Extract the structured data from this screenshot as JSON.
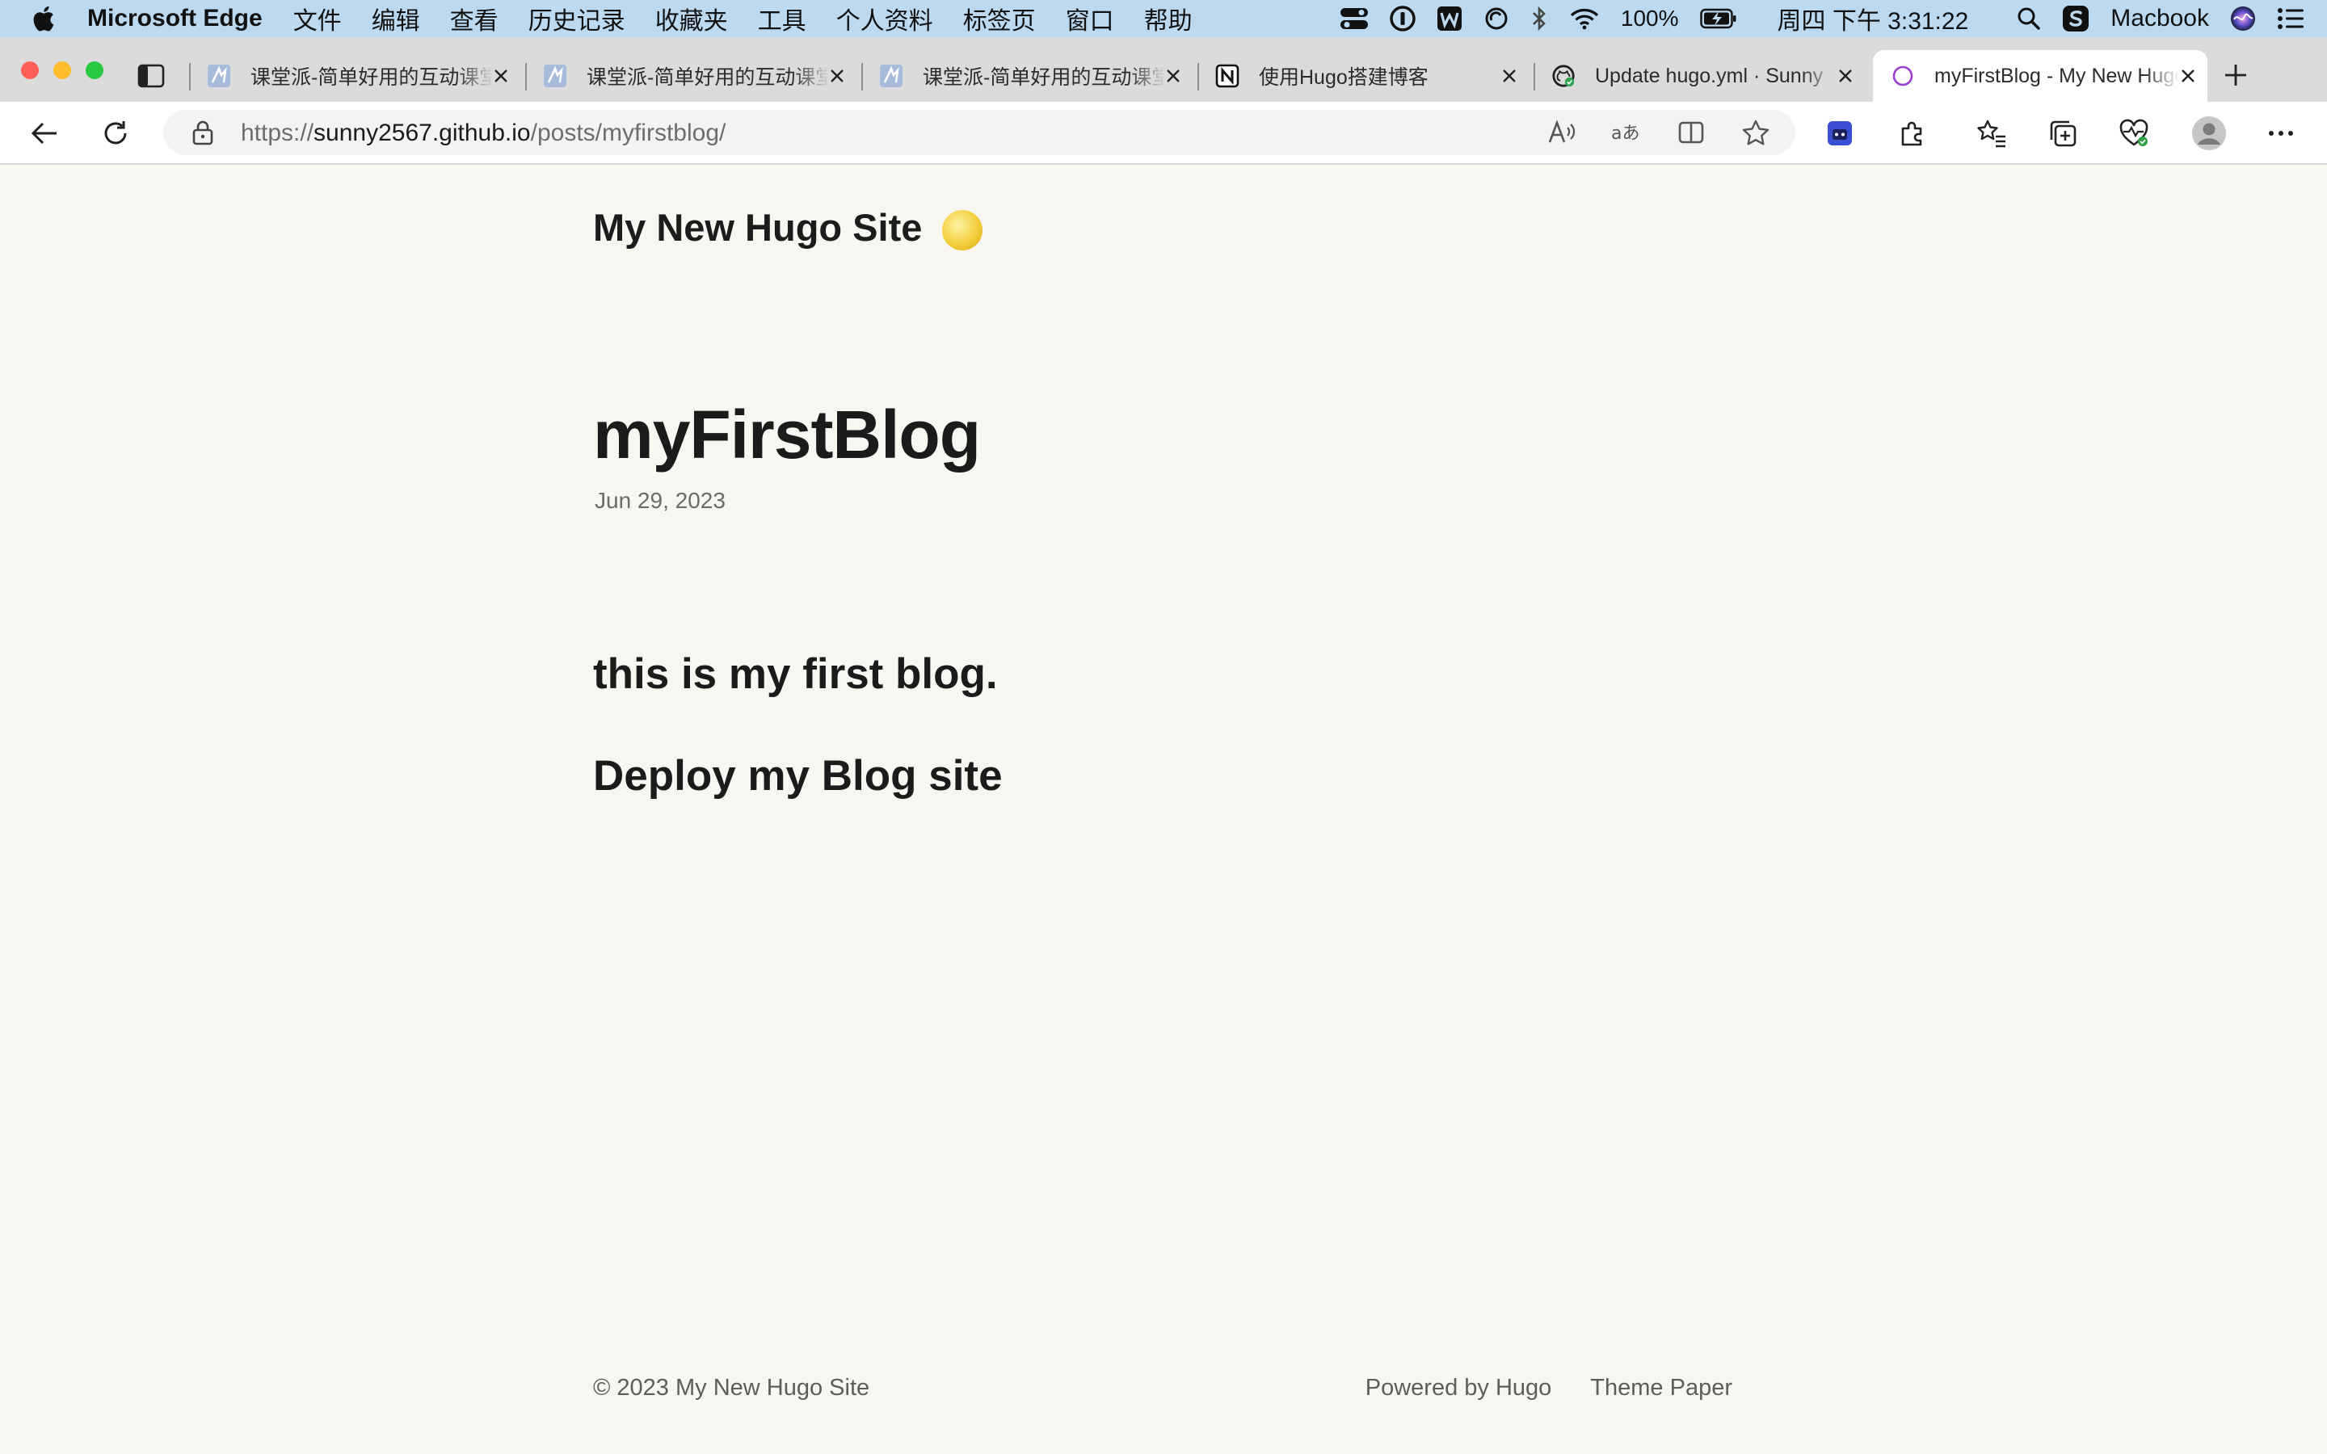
{
  "menubar": {
    "app_name": "Microsoft Edge",
    "items": [
      "文件",
      "编辑",
      "查看",
      "历史记录",
      "收藏夹",
      "工具",
      "个人资料",
      "标签页",
      "窗口",
      "帮助"
    ],
    "battery": "100%",
    "clock": "周四 下午 3:31:22",
    "user": "Macbook",
    "icons": [
      "apple-icon",
      "control-center-icon",
      "onepassword-icon",
      "wps-icon",
      "sync-icon",
      "bluetooth-icon",
      "wifi-icon",
      "battery-charging-icon",
      "spotlight-search-icon",
      "s-app-icon",
      "siri-icon",
      "notification-center-icon"
    ]
  },
  "tabs": [
    {
      "title": "课堂派-简单好用的互动课堂",
      "icon": "ketangpai-icon",
      "active": false
    },
    {
      "title": "课堂派-简单好用的互动课堂",
      "icon": "ketangpai-icon",
      "active": false
    },
    {
      "title": "课堂派-简单好用的互动课堂",
      "icon": "ketangpai-icon",
      "active": false
    },
    {
      "title": "使用Hugo搭建博客",
      "icon": "notion-icon",
      "active": false
    },
    {
      "title": "Update hugo.yml · Sunny",
      "icon": "github-icon",
      "active": false
    },
    {
      "title": "myFirstBlog - My New Hugo Site",
      "icon": "loading-icon",
      "active": true
    }
  ],
  "toolbar": {
    "url_scheme": "https://",
    "url_domain": "sunny2567.github.io",
    "url_path": "/posts/myfirstblog/"
  },
  "site": {
    "title": "My New Hugo Site"
  },
  "post": {
    "title": "myFirstBlog",
    "date": "Jun 29, 2023",
    "headings": [
      "this is my first blog.",
      "Deploy my Blog site"
    ]
  },
  "footer": {
    "copyright": "© 2023 My New Hugo Site",
    "powered_by": "Powered by Hugo",
    "theme": "Theme Paper"
  },
  "colors": {
    "menubar_bg": "#bcd9ef",
    "tabstrip_bg": "#dbdbdb",
    "page_bg": "#f8f6f1",
    "text": "#1c1c1c",
    "muted_text": "#5d5d5d"
  }
}
